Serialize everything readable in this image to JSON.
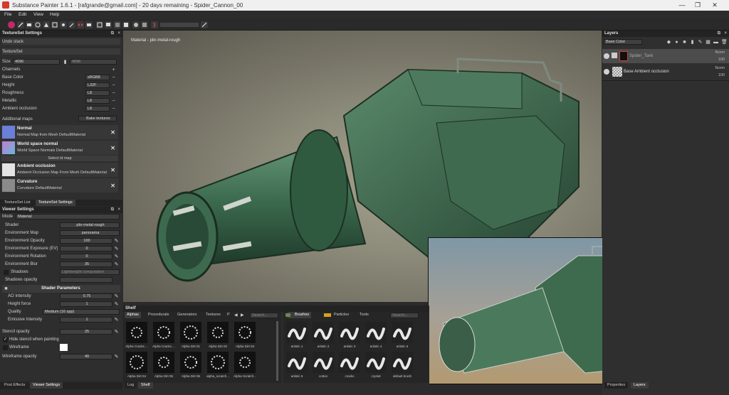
{
  "window": {
    "title": "Substance Painter 1.6.1 - [rafgrande@gmail.com] - 20 days remaining - Spider_Cannon_00",
    "minimize": "—",
    "maximize": "❐",
    "close": "✕"
  },
  "menu": [
    "File",
    "Edit",
    "View",
    "Help"
  ],
  "toolbar": {
    "icons": [
      "paint-icon",
      "brush-icon",
      "eraser-icon",
      "projection-icon",
      "polygon-fill-icon",
      "smudge-icon",
      "clone-icon",
      "picker-icon",
      "symmetry-icon",
      "camera-icon",
      "layout-icon",
      "display-icon",
      "view-icon",
      "render-icon",
      "settings-icon",
      "slider-icon"
    ]
  },
  "texture_set": {
    "header": "TextureSet Settings",
    "undo_stack": "Undo stack",
    "section": "TextureSet",
    "size_label": "Size",
    "size_value": "4096",
    "size_value2": "4096",
    "channels_label": "Channels",
    "channels": [
      {
        "name": "Base Color",
        "format": "sRGB8"
      },
      {
        "name": "Height",
        "format": "L32F"
      },
      {
        "name": "Roughness",
        "format": "L8"
      },
      {
        "name": "Metallic",
        "format": "L8"
      },
      {
        "name": "Ambient occlusion",
        "format": "L8"
      }
    ],
    "additional_maps_label": "Additional maps",
    "bake_textures": "Bake textures",
    "select_id_map": "Select id map",
    "maps": [
      {
        "name": "Normal",
        "desc": "Normal Map from Mesh DefaultMaterial",
        "color": "#6a7fd8"
      },
      {
        "name": "World space normal",
        "desc": "World Space Normals DefaultMaterial",
        "color": "#c27bd2"
      },
      {
        "name": "Ambient occlusion",
        "desc": "Ambient Occlusion Map From Mesh DefaultMaterial",
        "color": "#d8d8d8"
      },
      {
        "name": "Curvature",
        "desc": "Curvature DefaultMaterial",
        "color": "#8a8a8a"
      }
    ],
    "tabs": [
      "TextureSet List",
      "TextureSet Settings"
    ]
  },
  "viewer": {
    "header": "Viewer Settings",
    "mode_label": "Mode",
    "mode_value": "Material",
    "shader_label": "Shader",
    "shader_value": "pbr-metal-rough",
    "env_map_label": "Environment Map",
    "env_map_value": "panorama",
    "sliders": [
      {
        "label": "Environment Opacity",
        "value": "100"
      },
      {
        "label": "Environment Exposure (EV)",
        "value": "0"
      },
      {
        "label": "Environment Rotation",
        "value": "0"
      },
      {
        "label": "Environment Blur",
        "value": "35"
      }
    ],
    "shadows_label": "Shadows",
    "shadows_value": "Lightweight computation",
    "shadows_opacity_label": "Shadows opacity",
    "shader_params_header": "Shader Parameters",
    "ao_label": "AO Intensity",
    "ao_value": "0.75",
    "height_force_label": "Height force",
    "height_force_value": "1",
    "quality_label": "Quality",
    "quality_value": "Medium (16 spp)",
    "emissive_label": "Emissive Intensity",
    "emissive_value": "1",
    "stencil_label": "Stencil opacity",
    "stencil_value": "25",
    "hide_stencil_label": "Hide stencil when painting",
    "wireframe_label": "Wireframe",
    "wireframe_opacity_label": "Wireframe opacity",
    "wireframe_opacity_value": "40",
    "tabs": [
      "Post Effects",
      "Viewer Settings"
    ]
  },
  "viewport": {
    "label": "Material - pbr-metal-rough"
  },
  "layers": {
    "header": "Layers",
    "channel": "Base Color",
    "items": [
      {
        "name": "Spider_Tank",
        "blend": "Norm",
        "opacity": "100"
      },
      {
        "name": "Base Ambient occlusion",
        "blend": "Norm",
        "opacity": "100"
      }
    ],
    "tabs": [
      "Properties",
      "Layers"
    ]
  },
  "shelf": {
    "header": "Shelf",
    "tabs": [
      "Alphas",
      "Procedurals",
      "Generators",
      "Textures",
      "P"
    ],
    "search_placeholder": "Search...",
    "alphas": [
      "Alpha Cracks ...",
      "Alpha Cracks ...",
      "Alpha Dirt 01",
      "Alpha Dirt 02",
      "Alpha Dirt 03",
      "Alpha Dirt 04",
      "Alpha Dirt 05",
      "Alpha Dirt 06",
      "alpha_scratch...",
      "Alpha Scratch..."
    ],
    "right_tabs": [
      "Brushes",
      "Particles",
      "Tools"
    ],
    "right_search": "Search...",
    "brushes": [
      "artistic 1",
      "artistic 2",
      "artistic 3",
      "artistic 4",
      "artistic 5",
      "artistic 6",
      "cotton",
      "cracks",
      "crystal",
      "default brush"
    ],
    "bottom_tabs": [
      "Log",
      "Shelf"
    ]
  },
  "colors": {
    "accent": "#c0296a",
    "tank_green": "#3e6a4d"
  }
}
